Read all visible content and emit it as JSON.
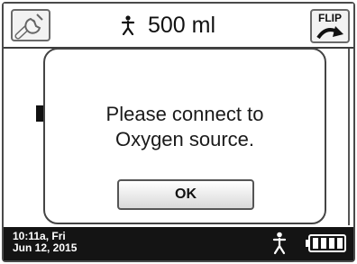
{
  "header": {
    "volume_text": "500 ml",
    "flip_label": "FLIP"
  },
  "dialog": {
    "message_line1": "Please connect to",
    "message_line2": "Oxygen source.",
    "ok_label": "OK"
  },
  "status": {
    "time_line": "10:11a, Fri",
    "date_line": "Jun 12, 2015"
  },
  "icons": {
    "settings": "wrench-icon",
    "flip": "flip-arrow-icon",
    "patient": "person-icon",
    "battery": "battery-icon"
  },
  "colors": {
    "status_bar": "#141414",
    "frame": "#4a4a4a"
  }
}
